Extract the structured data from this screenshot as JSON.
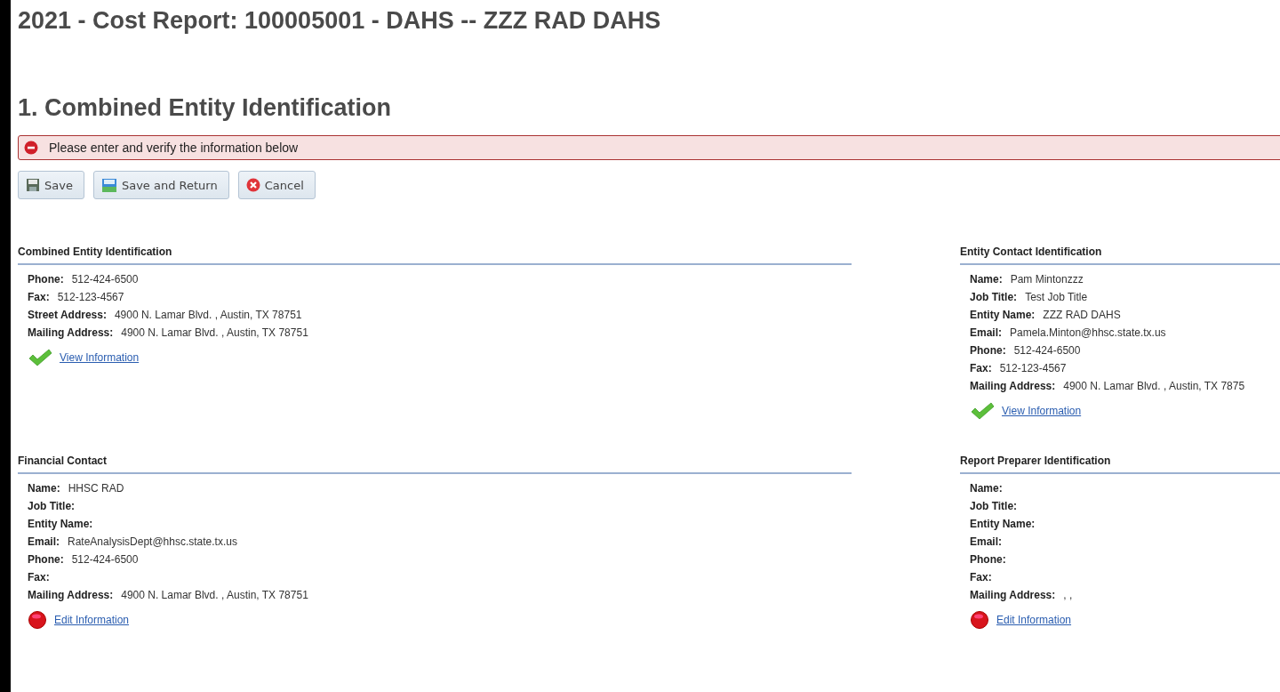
{
  "page_title": "2021 - Cost Report: 100005001 - DAHS -- ZZZ RAD DAHS",
  "section_title": "1. Combined Entity Identification",
  "alert": {
    "kind": "error",
    "message": "Please enter and verify the information below"
  },
  "buttons": [
    {
      "label": "Save",
      "kind": "save"
    },
    {
      "label": "Save and Return",
      "kind": "save-return"
    },
    {
      "label": "Cancel",
      "kind": "cancel"
    }
  ],
  "panels": [
    {
      "title": "Combined Entity Identification",
      "complete": true,
      "link": "View Information",
      "fields": [
        {
          "label": "Phone:",
          "value": "512-424-6500"
        },
        {
          "label": "Fax:",
          "value": "512-123-4567"
        },
        {
          "label": "Street Address:",
          "value": "4900 N. Lamar Blvd. , Austin, TX 78751"
        },
        {
          "label": "Mailing Address:",
          "value": "4900 N. Lamar Blvd. , Austin, TX 78751"
        }
      ]
    },
    {
      "title": "Entity Contact Identification",
      "complete": true,
      "link": "View Information",
      "fields": [
        {
          "label": "Name:",
          "value": "Pam Mintonzzz"
        },
        {
          "label": "Job Title:",
          "value": "Test Job Title"
        },
        {
          "label": "Entity Name:",
          "value": "ZZZ RAD DAHS"
        },
        {
          "label": "Email:",
          "value": "Pamela.Minton@hhsc.state.tx.us"
        },
        {
          "label": "Phone:",
          "value": "512-424-6500"
        },
        {
          "label": "Fax:",
          "value": "512-123-4567"
        },
        {
          "label": "Mailing Address:",
          "value": "4900 N. Lamar Blvd. , Austin, TX 7875"
        }
      ]
    },
    {
      "title": "Financial Contact",
      "complete": false,
      "link": "Edit Information",
      "fields": [
        {
          "label": "Name:",
          "value": "HHSC RAD"
        },
        {
          "label": "Job Title:"
        },
        {
          "label": "Entity Name:"
        },
        {
          "label": "Email:",
          "value": "RateAnalysisDept@hhsc.state.tx.us"
        },
        {
          "label": "Phone:",
          "value": "512-424-6500"
        },
        {
          "label": "Fax:"
        },
        {
          "label": "Mailing Address:",
          "value": "4900 N. Lamar Blvd. , Austin, TX 78751"
        }
      ]
    },
    {
      "title": "Report Preparer Identification",
      "complete": false,
      "link": "Edit Information",
      "fields": [
        {
          "label": "Name:"
        },
        {
          "label": "Job Title:"
        },
        {
          "label": "Entity Name:"
        },
        {
          "label": "Email:"
        },
        {
          "label": "Phone:"
        },
        {
          "label": "Fax:"
        },
        {
          "label": "Mailing Address:",
          "value": ", ,"
        }
      ]
    }
  ]
}
